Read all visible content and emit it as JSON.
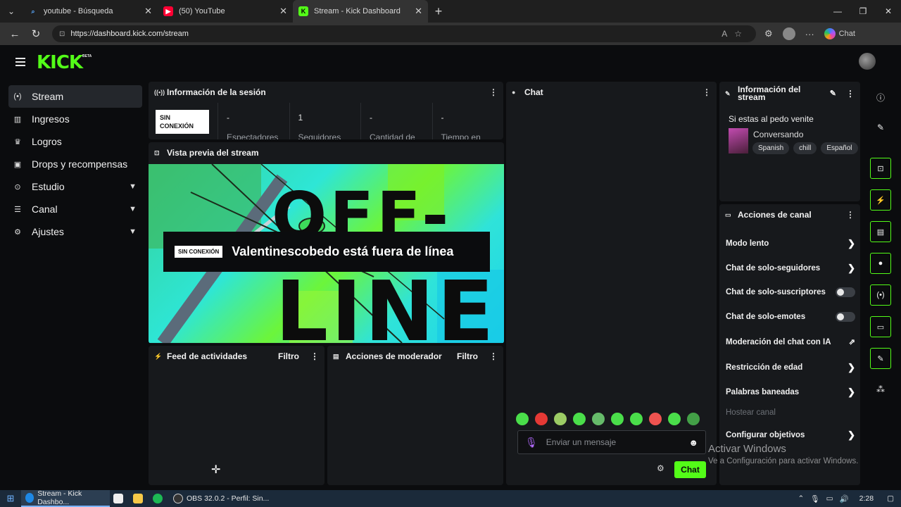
{
  "browser": {
    "tabs": [
      {
        "title": "youtube - Búsqueda",
        "active": false
      },
      {
        "title": "(50) YouTube",
        "active": false
      },
      {
        "title": "Stream - Kick Dashboard",
        "active": true
      }
    ],
    "url": "https://dashboard.kick.com/stream",
    "copilot_label": "Chat"
  },
  "app": {
    "logo": "KICK",
    "logo_badge": "BETA",
    "accent": "#53fc18"
  },
  "sidebar": {
    "items": [
      {
        "label": "Stream",
        "icon": "broadcast-icon",
        "active": true
      },
      {
        "label": "Ingresos",
        "icon": "chart-icon"
      },
      {
        "label": "Logros",
        "icon": "trophy-icon"
      },
      {
        "label": "Drops y recompensas",
        "icon": "gift-icon"
      },
      {
        "label": "Estudio",
        "icon": "studio-icon",
        "expandable": true
      },
      {
        "label": "Canal",
        "icon": "channel-icon",
        "expandable": true
      },
      {
        "label": "Ajustes",
        "icon": "gear-icon",
        "expandable": true
      }
    ]
  },
  "session": {
    "title": "Información de la sesión",
    "status_badge": "SIN CONEXIÓN",
    "stats": [
      {
        "value": "-",
        "label": "Espectadores"
      },
      {
        "value": "1",
        "label": "Seguidores"
      },
      {
        "value": "-",
        "label": "Cantidad de"
      },
      {
        "value": "-",
        "label": "Tiempo en"
      }
    ]
  },
  "preview": {
    "title": "Vista previa del stream",
    "badge": "SIN CONEXIÓN",
    "message": "Valentinescobedo está fuera de línea",
    "art_word_top": "OFF-",
    "art_word_bottom": "LINE"
  },
  "activity": {
    "title": "Feed de actividades",
    "filter": "Filtro"
  },
  "modactions": {
    "title": "Acciones de moderador",
    "filter": "Filtro"
  },
  "chat": {
    "title": "Chat",
    "placeholder": "Enviar un mensaje",
    "send_label": "Chat",
    "emote_count": 10
  },
  "stream_info": {
    "title": "Información del stream",
    "stream_title": "Si estas al pedo venite",
    "category": "Conversando",
    "tags": [
      "Spanish",
      "chill",
      "Español"
    ]
  },
  "channel_actions": {
    "title": "Acciones de canal",
    "items": [
      {
        "label": "Modo lento",
        "control": "chevron"
      },
      {
        "label": "Chat de solo-seguidores",
        "control": "chevron"
      },
      {
        "label": "Chat de solo-suscriptores",
        "control": "toggle",
        "on": false
      },
      {
        "label": "Chat de solo-emotes",
        "control": "toggle",
        "on": false
      },
      {
        "label": "Moderación del chat con IA",
        "control": "external"
      },
      {
        "label": "Restricción de edad",
        "control": "chevron"
      },
      {
        "label": "Palabras baneadas",
        "control": "chevron"
      },
      {
        "label": "Hostear canal",
        "control": "none",
        "disabled": true
      },
      {
        "label": "Configurar objetivos",
        "control": "chevron"
      }
    ]
  },
  "watermark": {
    "line1": "Activar Windows",
    "line2": "Ve a Configuración para activar Windows."
  },
  "taskbar": {
    "apps": [
      {
        "label": "Stream - Kick Dashbo...",
        "active": true
      },
      {
        "label": "OBS 32.0.2 - Perfil: Sin..."
      }
    ],
    "time": "2:28"
  }
}
